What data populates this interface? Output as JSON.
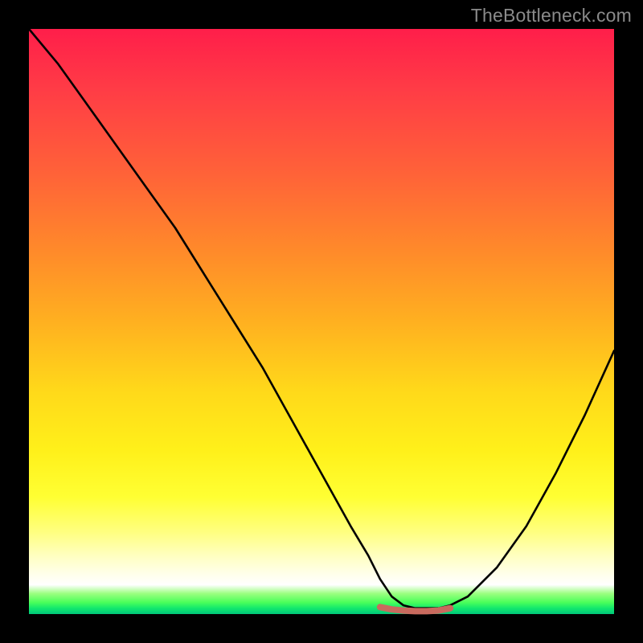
{
  "watermark": "TheBottleneck.com",
  "chart_data": {
    "type": "line",
    "title": "",
    "xlabel": "",
    "ylabel": "",
    "xlim": [
      0,
      100
    ],
    "ylim": [
      0,
      100
    ],
    "grid": false,
    "legend": false,
    "series": [
      {
        "name": "bottleneck-curve",
        "x": [
          0,
          5,
          10,
          15,
          20,
          25,
          30,
          35,
          40,
          45,
          50,
          55,
          58,
          60,
          62,
          64,
          66,
          68,
          70,
          72,
          75,
          80,
          85,
          90,
          95,
          100
        ],
        "values": [
          100,
          94,
          87,
          80,
          73,
          66,
          58,
          50,
          42,
          33,
          24,
          15,
          10,
          6,
          3,
          1.5,
          1,
          1,
          1,
          1.5,
          3,
          8,
          15,
          24,
          34,
          45
        ]
      },
      {
        "name": "optimal-range-marker",
        "x": [
          60,
          62,
          64,
          66,
          68,
          70,
          72
        ],
        "values": [
          1.2,
          0.8,
          0.6,
          0.5,
          0.5,
          0.6,
          1.0
        ]
      }
    ],
    "colors": {
      "curve": "#000000",
      "marker": "#c96a5e",
      "gradient_top": "#ff1e4a",
      "gradient_mid": "#ffd91a",
      "gradient_bottom": "#00c87a"
    }
  }
}
